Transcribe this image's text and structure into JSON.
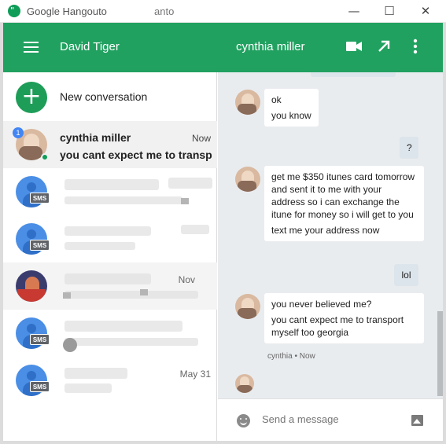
{
  "window": {
    "title": "Google Hangouto",
    "ghost_title": "anto",
    "minimize": "—",
    "maximize": "☐",
    "close": "✕"
  },
  "header": {
    "user_name": "David Tiger",
    "chat_title": "cynthia miller"
  },
  "new_conversation": "New conversation",
  "conversations": [
    {
      "name": "cynthia miller",
      "time": "Now",
      "preview": "you cant expect me to transport",
      "badge": "1"
    },
    {
      "time": "",
      "preview": ""
    },
    {
      "time": "",
      "preview": ""
    },
    {
      "time": "Nov",
      "preview": ""
    },
    {
      "time": "",
      "preview": ""
    },
    {
      "time": "May 31",
      "preview": ""
    }
  ],
  "sms_label": "SMS",
  "messages": [
    {
      "from": "them",
      "lines": [
        "ok",
        "you know"
      ]
    },
    {
      "from": "me",
      "lines": [
        "?"
      ]
    },
    {
      "from": "them",
      "lines": [
        "get me $350 itunes card tomorrow and sent it to me with your address so i can exchange the itune for money so i will get to you",
        "text me your address now"
      ]
    },
    {
      "from": "me",
      "lines": [
        "lol"
      ]
    },
    {
      "from": "them",
      "lines": [
        "you never believed me?",
        "you cant expect me to transport myself too georgia"
      ]
    }
  ],
  "last_status": "cynthia • Now",
  "composer": {
    "placeholder": "Send a message"
  },
  "colors": {
    "header": "#21a160",
    "accent": "#1e9d58",
    "chat_bg": "#e9ecef"
  }
}
